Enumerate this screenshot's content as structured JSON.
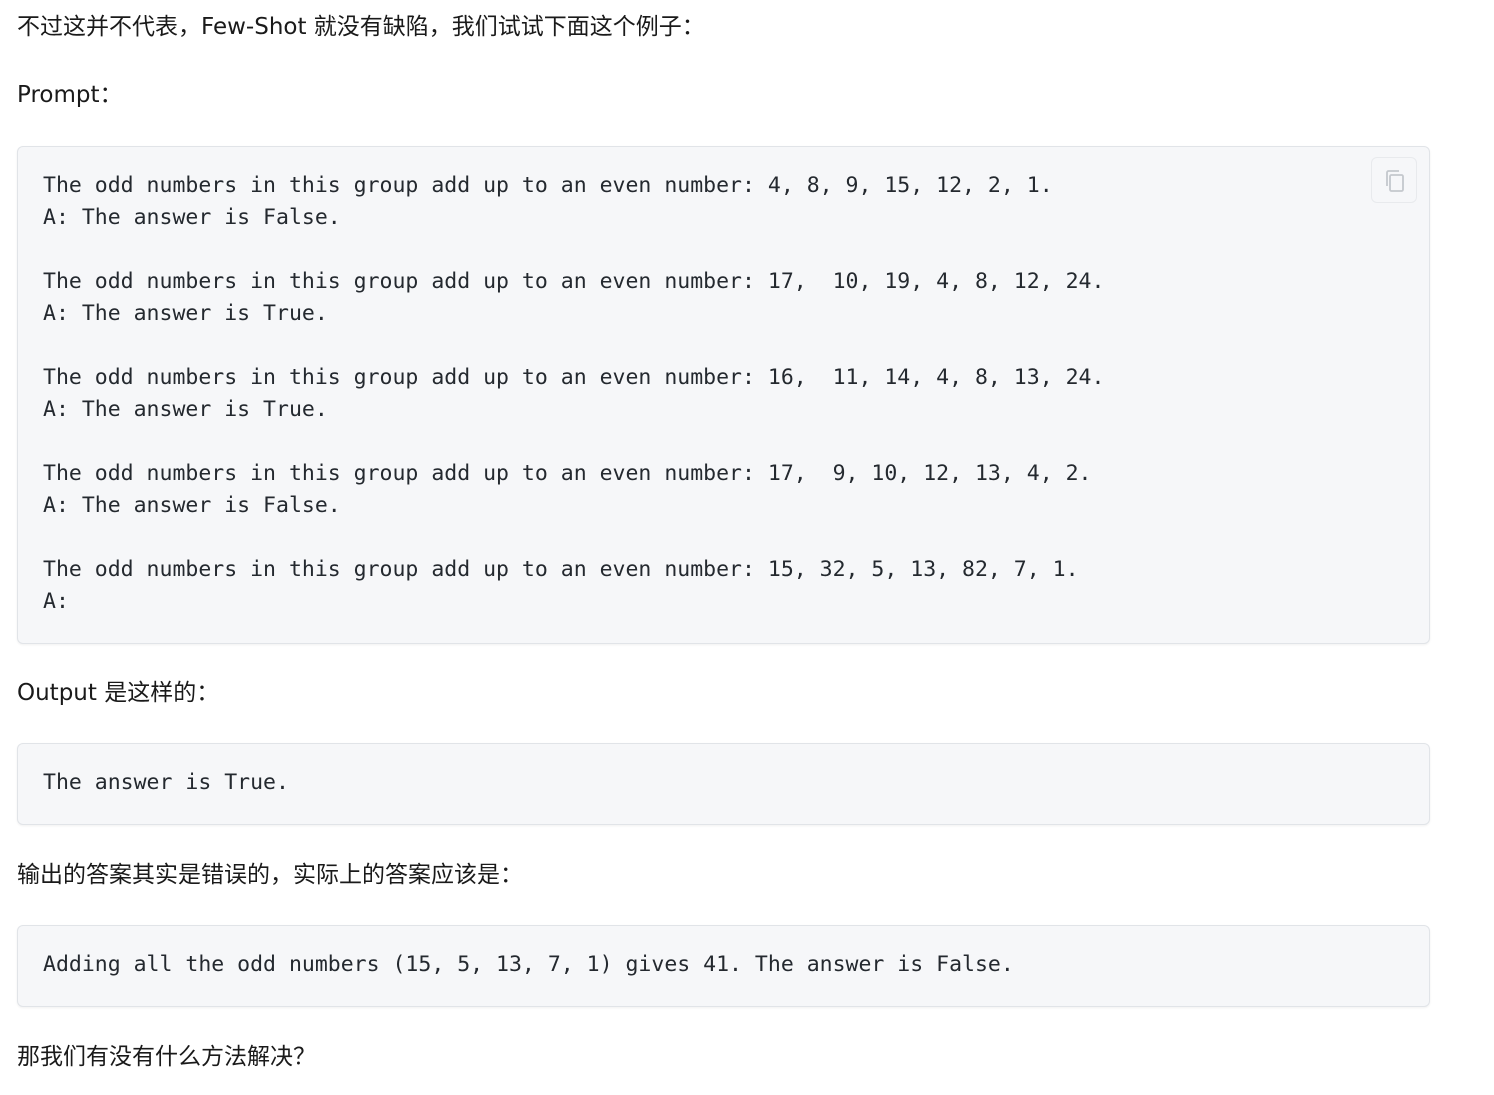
{
  "intro": "不过这并不代表，Few-Shot 就没有缺陷，我们试试下面这个例子：",
  "prompt_label": "Prompt：",
  "prompt_block": {
    "lines": [
      "The odd numbers in this group add up to an even number: 4, 8, 9, 15, 12, 2, 1.",
      "A: The answer is False.",
      "",
      "The odd numbers in this group add up to an even number: 17,  10, 19, 4, 8, 12, 24.",
      "A: The answer is True.",
      "",
      "The odd numbers in this group add up to an even number: 16,  11, 14, 4, 8, 13, 24.",
      "A: The answer is True.",
      "",
      "The odd numbers in this group add up to an even number: 17,  9, 10, 12, 13, 4, 2.",
      "A: The answer is False.",
      "",
      "The odd numbers in this group add up to an even number: 15, 32, 5, 13, 82, 7, 1.",
      "A:"
    ],
    "copy_icon": "copy-icon"
  },
  "output_label": "Output 是这样的：",
  "output_block": {
    "text": "The answer is True."
  },
  "correction_label": "输出的答案其实是错误的，实际上的答案应该是：",
  "correction_block": {
    "text": "Adding all the odd numbers (15, 5, 13, 7, 1) gives 41. The answer is False."
  },
  "closing": "那我们有没有什么方法解决？"
}
